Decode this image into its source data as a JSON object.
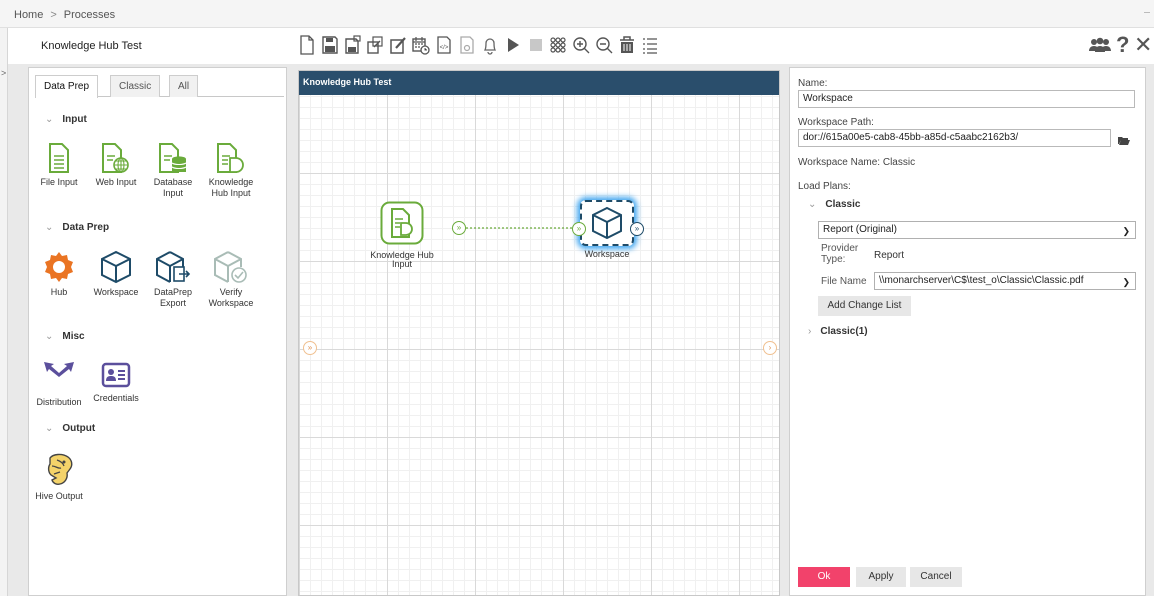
{
  "breadcrumb": {
    "home": "Home",
    "separator": ">",
    "current": "Processes"
  },
  "process_name": "Knowledge Hub Test",
  "toolbar": {
    "icons": [
      "new-icon",
      "save-icon",
      "save-as-icon",
      "resize-icon",
      "edit-icon",
      "schedule-icon",
      "export-icon",
      "import-icon",
      "bell-icon",
      "play-icon",
      "stop-icon",
      "grid-icon",
      "zoom-in-icon",
      "zoom-out-icon",
      "delete-icon",
      "list-icon"
    ],
    "right_icons": [
      "users-icon",
      "help-icon",
      "close-icon"
    ],
    "help_glyph": "?",
    "close_glyph": "✕"
  },
  "palette": {
    "tabs": [
      {
        "label": "Data Prep",
        "active": true
      },
      {
        "label": "Classic",
        "active": false
      },
      {
        "label": "All",
        "active": false
      }
    ],
    "sections": [
      {
        "title": "Input",
        "items": [
          {
            "label": "File Input",
            "icon": "file-input-icon"
          },
          {
            "label": "Web Input",
            "icon": "web-input-icon"
          },
          {
            "label": "Database Input",
            "icon": "database-input-icon"
          },
          {
            "label": "Knowledge Hub Input",
            "icon": "knowledge-hub-input-icon"
          }
        ]
      },
      {
        "title": "Data Prep",
        "items": [
          {
            "label": "Hub",
            "icon": "hub-icon"
          },
          {
            "label": "Workspace",
            "icon": "workspace-icon"
          },
          {
            "label": "DataPrep Export",
            "icon": "dataprep-export-icon"
          },
          {
            "label": "Verify Workspace",
            "icon": "verify-workspace-icon"
          }
        ]
      },
      {
        "title": "Misc",
        "items": [
          {
            "label": "Distribution",
            "icon": "distribution-icon"
          },
          {
            "label": "Credentials",
            "icon": "credentials-icon"
          }
        ]
      },
      {
        "title": "Output",
        "items": [
          {
            "label": "Hive Output",
            "icon": "hive-output-icon"
          }
        ]
      }
    ]
  },
  "canvas": {
    "title": "Knowledge Hub Test",
    "nodes": [
      {
        "label": "Knowledge Hub Input",
        "icon": "knowledge-hub-input-icon"
      },
      {
        "label": "Workspace",
        "icon": "workspace-icon",
        "selected": true
      }
    ],
    "left_port_glyph": "»",
    "right_port_glyph": "›"
  },
  "properties": {
    "name_label": "Name:",
    "name_value": "Workspace",
    "path_label": "Workspace Path:",
    "path_value": "dor://615a00e5-cab8-45bb-a85d-c5aabc2162b3/",
    "workspace_name": "Workspace Name: Classic",
    "load_plans_label": "Load Plans:",
    "plans": [
      {
        "title": "Classic",
        "expanded": true,
        "report": "Report (Original)",
        "provider_type_label": "Provider Type:",
        "provider_type": "Report",
        "file_name_label": "File Name",
        "file_name": "\\\\monarchserver\\C$\\test_o\\Classic\\Classic.pdf",
        "add_change_list": "Add Change List"
      },
      {
        "title": "Classic(1)",
        "expanded": false
      }
    ],
    "buttons": {
      "ok": "Ok",
      "apply": "Apply",
      "cancel": "Cancel"
    }
  },
  "colors": {
    "green": "#6aab3b",
    "orange": "#ea7423",
    "purple": "#5b4f9c",
    "teal": "#1e4b68",
    "gray_icon": "#a9bcb6",
    "ok": "#f2426b",
    "canvas_header": "#2a4e6c",
    "selection_glow": "#41a6ef"
  }
}
